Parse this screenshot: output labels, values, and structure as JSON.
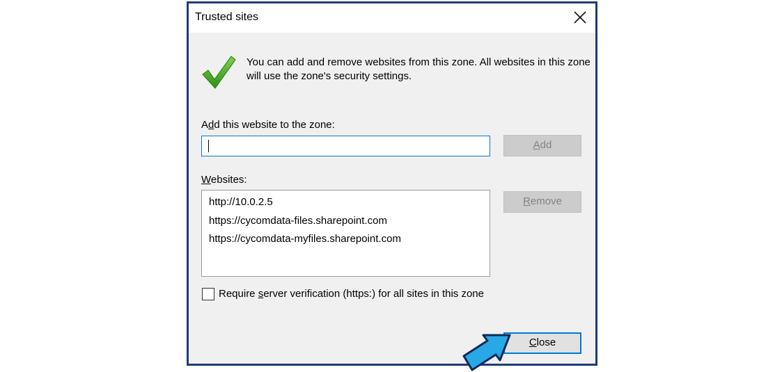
{
  "dialog": {
    "title": "Trusted sites",
    "info_text": "You can add and remove websites from this zone. All websites in this zone will use the zone's security settings.",
    "add_label_pre": "A",
    "add_label_key": "d",
    "add_label_post": "d this website to the zone:",
    "input_value": "",
    "add_button_key": "A",
    "add_button_rest": "dd",
    "websites_label_key": "W",
    "websites_label_rest": "ebsites:",
    "websites": [
      "http://10.0.2.5",
      "https://cycomdata-files.sharepoint.com",
      "https://cycomdata-myfiles.sharepoint.com"
    ],
    "remove_button_key": "R",
    "remove_button_rest": "emove",
    "require_pre": "Require ",
    "require_key": "s",
    "require_post": "erver verification (https:) for all sites in this zone",
    "require_checked": false,
    "close_button_key": "C",
    "close_button_rest": "lose"
  },
  "icons": {
    "check": "green-check-icon",
    "close": "close-icon",
    "pointer": "blue-arrow-pointer-icon"
  },
  "colors": {
    "frame": "#1f3a7a",
    "focus": "#0078d7",
    "check_green": "#4caf2a",
    "arrow_fill": "#29a8e6",
    "arrow_stroke": "#0b2a5a"
  }
}
